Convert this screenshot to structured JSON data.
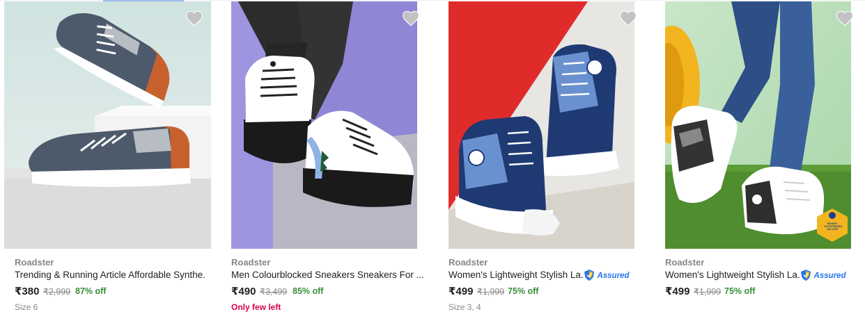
{
  "colors": {
    "accent": "#2874f0",
    "discount": "#388e3c",
    "few_left": "#d9004d",
    "muted": "#878787"
  },
  "products": [
    {
      "brand": "Roadster",
      "title": "Trending & Running Article Affordable Synthe...",
      "price": "₹380",
      "mrp": "₹2,999",
      "discount": "87% off",
      "extra": "Size 6",
      "assured": ""
    },
    {
      "brand": "Roadster",
      "title": "Men Colourblocked Sneakers Sneakers For ...",
      "price": "₹490",
      "mrp": "₹3,499",
      "discount": "85% off",
      "extra": "Only few left",
      "assured": ""
    },
    {
      "brand": "Roadster",
      "title": "Women's Lightweight Stylish La...",
      "price": "₹499",
      "mrp": "₹1,999",
      "discount": "75% off",
      "extra": "Size 3, 4",
      "assured": "Assured"
    },
    {
      "brand": "Roadster",
      "title": "Women's Lightweight Stylish La...",
      "price": "₹499",
      "mrp": "₹1,999",
      "discount": "75% off",
      "extra": "",
      "assured": "Assured",
      "badge": "BRAND AUTHORISED SELLER"
    }
  ]
}
